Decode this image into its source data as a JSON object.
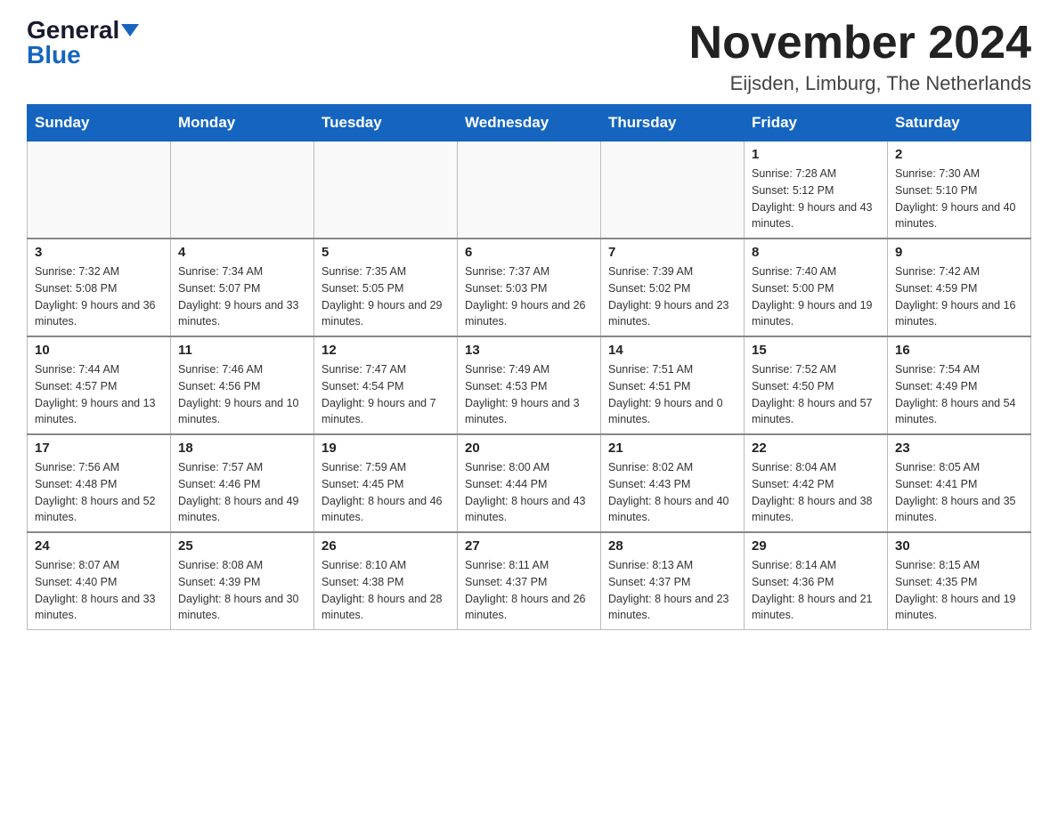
{
  "header": {
    "logo_general": "General",
    "logo_blue": "Blue",
    "month_title": "November 2024",
    "location": "Eijsden, Limburg, The Netherlands"
  },
  "days_of_week": [
    "Sunday",
    "Monday",
    "Tuesday",
    "Wednesday",
    "Thursday",
    "Friday",
    "Saturday"
  ],
  "weeks": [
    [
      {
        "day": "",
        "info": ""
      },
      {
        "day": "",
        "info": ""
      },
      {
        "day": "",
        "info": ""
      },
      {
        "day": "",
        "info": ""
      },
      {
        "day": "",
        "info": ""
      },
      {
        "day": "1",
        "info": "Sunrise: 7:28 AM\nSunset: 5:12 PM\nDaylight: 9 hours and 43 minutes."
      },
      {
        "day": "2",
        "info": "Sunrise: 7:30 AM\nSunset: 5:10 PM\nDaylight: 9 hours and 40 minutes."
      }
    ],
    [
      {
        "day": "3",
        "info": "Sunrise: 7:32 AM\nSunset: 5:08 PM\nDaylight: 9 hours and 36 minutes."
      },
      {
        "day": "4",
        "info": "Sunrise: 7:34 AM\nSunset: 5:07 PM\nDaylight: 9 hours and 33 minutes."
      },
      {
        "day": "5",
        "info": "Sunrise: 7:35 AM\nSunset: 5:05 PM\nDaylight: 9 hours and 29 minutes."
      },
      {
        "day": "6",
        "info": "Sunrise: 7:37 AM\nSunset: 5:03 PM\nDaylight: 9 hours and 26 minutes."
      },
      {
        "day": "7",
        "info": "Sunrise: 7:39 AM\nSunset: 5:02 PM\nDaylight: 9 hours and 23 minutes."
      },
      {
        "day": "8",
        "info": "Sunrise: 7:40 AM\nSunset: 5:00 PM\nDaylight: 9 hours and 19 minutes."
      },
      {
        "day": "9",
        "info": "Sunrise: 7:42 AM\nSunset: 4:59 PM\nDaylight: 9 hours and 16 minutes."
      }
    ],
    [
      {
        "day": "10",
        "info": "Sunrise: 7:44 AM\nSunset: 4:57 PM\nDaylight: 9 hours and 13 minutes."
      },
      {
        "day": "11",
        "info": "Sunrise: 7:46 AM\nSunset: 4:56 PM\nDaylight: 9 hours and 10 minutes."
      },
      {
        "day": "12",
        "info": "Sunrise: 7:47 AM\nSunset: 4:54 PM\nDaylight: 9 hours and 7 minutes."
      },
      {
        "day": "13",
        "info": "Sunrise: 7:49 AM\nSunset: 4:53 PM\nDaylight: 9 hours and 3 minutes."
      },
      {
        "day": "14",
        "info": "Sunrise: 7:51 AM\nSunset: 4:51 PM\nDaylight: 9 hours and 0 minutes."
      },
      {
        "day": "15",
        "info": "Sunrise: 7:52 AM\nSunset: 4:50 PM\nDaylight: 8 hours and 57 minutes."
      },
      {
        "day": "16",
        "info": "Sunrise: 7:54 AM\nSunset: 4:49 PM\nDaylight: 8 hours and 54 minutes."
      }
    ],
    [
      {
        "day": "17",
        "info": "Sunrise: 7:56 AM\nSunset: 4:48 PM\nDaylight: 8 hours and 52 minutes."
      },
      {
        "day": "18",
        "info": "Sunrise: 7:57 AM\nSunset: 4:46 PM\nDaylight: 8 hours and 49 minutes."
      },
      {
        "day": "19",
        "info": "Sunrise: 7:59 AM\nSunset: 4:45 PM\nDaylight: 8 hours and 46 minutes."
      },
      {
        "day": "20",
        "info": "Sunrise: 8:00 AM\nSunset: 4:44 PM\nDaylight: 8 hours and 43 minutes."
      },
      {
        "day": "21",
        "info": "Sunrise: 8:02 AM\nSunset: 4:43 PM\nDaylight: 8 hours and 40 minutes."
      },
      {
        "day": "22",
        "info": "Sunrise: 8:04 AM\nSunset: 4:42 PM\nDaylight: 8 hours and 38 minutes."
      },
      {
        "day": "23",
        "info": "Sunrise: 8:05 AM\nSunset: 4:41 PM\nDaylight: 8 hours and 35 minutes."
      }
    ],
    [
      {
        "day": "24",
        "info": "Sunrise: 8:07 AM\nSunset: 4:40 PM\nDaylight: 8 hours and 33 minutes."
      },
      {
        "day": "25",
        "info": "Sunrise: 8:08 AM\nSunset: 4:39 PM\nDaylight: 8 hours and 30 minutes."
      },
      {
        "day": "26",
        "info": "Sunrise: 8:10 AM\nSunset: 4:38 PM\nDaylight: 8 hours and 28 minutes."
      },
      {
        "day": "27",
        "info": "Sunrise: 8:11 AM\nSunset: 4:37 PM\nDaylight: 8 hours and 26 minutes."
      },
      {
        "day": "28",
        "info": "Sunrise: 8:13 AM\nSunset: 4:37 PM\nDaylight: 8 hours and 23 minutes."
      },
      {
        "day": "29",
        "info": "Sunrise: 8:14 AM\nSunset: 4:36 PM\nDaylight: 8 hours and 21 minutes."
      },
      {
        "day": "30",
        "info": "Sunrise: 8:15 AM\nSunset: 4:35 PM\nDaylight: 8 hours and 19 minutes."
      }
    ]
  ]
}
